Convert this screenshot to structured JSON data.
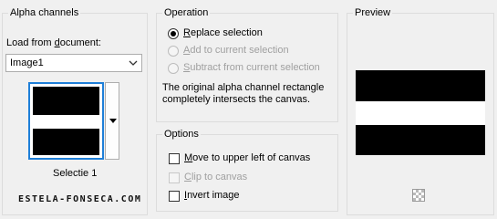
{
  "alpha_channels": {
    "title": "Alpha channels",
    "load_from_label_pre": "Load from ",
    "load_from_label_u": "d",
    "load_from_label_post": "ocument:",
    "document_select": "Image1",
    "selected_channel": "Selectie 1"
  },
  "watermark": "ESTELA-FONSECA.COM",
  "operation": {
    "title": "Operation",
    "options": [
      {
        "u": "R",
        "rest": "eplace selection",
        "checked": true,
        "disabled": false
      },
      {
        "u": "A",
        "rest": "dd to current selection",
        "checked": false,
        "disabled": true
      },
      {
        "u": "S",
        "rest": "ubtract from current selection",
        "checked": false,
        "disabled": true
      }
    ],
    "description": "The original alpha channel rectangle completely intersects the canvas."
  },
  "options": {
    "title": "Options",
    "items": [
      {
        "u": "M",
        "rest": "ove to upper left of canvas",
        "checked": false,
        "disabled": false
      },
      {
        "pre": "",
        "u": "C",
        "rest": "lip to canvas",
        "checked": false,
        "disabled": true
      },
      {
        "u": "I",
        "rest": "nvert image",
        "checked": false,
        "disabled": false
      }
    ]
  },
  "preview": {
    "title": "Preview",
    "icon": "checkerboard-icon"
  }
}
